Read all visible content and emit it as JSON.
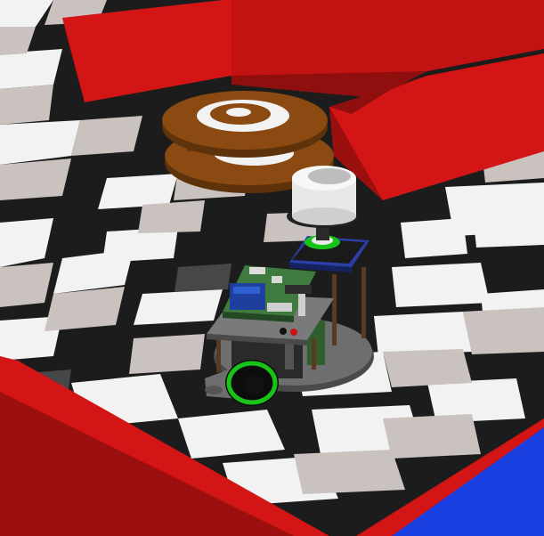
{
  "scene": {
    "colors": {
      "floor_black": "#1c1c1c",
      "floor_white": "#f2f2f2",
      "floor_gray": "#c9c2be",
      "floor_dark": "#5a5a5a",
      "wall_red": "#d41515",
      "wall_red_dark": "#9b0f0f",
      "wall_blue": "#1a3fe0",
      "spool_brown": "#8a4a12",
      "spool_brown_dark": "#5e320b",
      "robot_plate": "#6e6e6e",
      "pcb_green": "#3f7a3f",
      "wheel_green": "#19c419",
      "lidar_white": "#e8e8e8",
      "lidar_base_blue": "#2b3fa8"
    },
    "objects": {
      "floor": "checkerboard-floor",
      "walls": [
        "red-wall-top",
        "red-wall-right",
        "red-wall-bottom-left",
        "blue-wall-bottom-right"
      ],
      "spool": "brown-cable-spool",
      "robot": "mobile-robot"
    }
  }
}
